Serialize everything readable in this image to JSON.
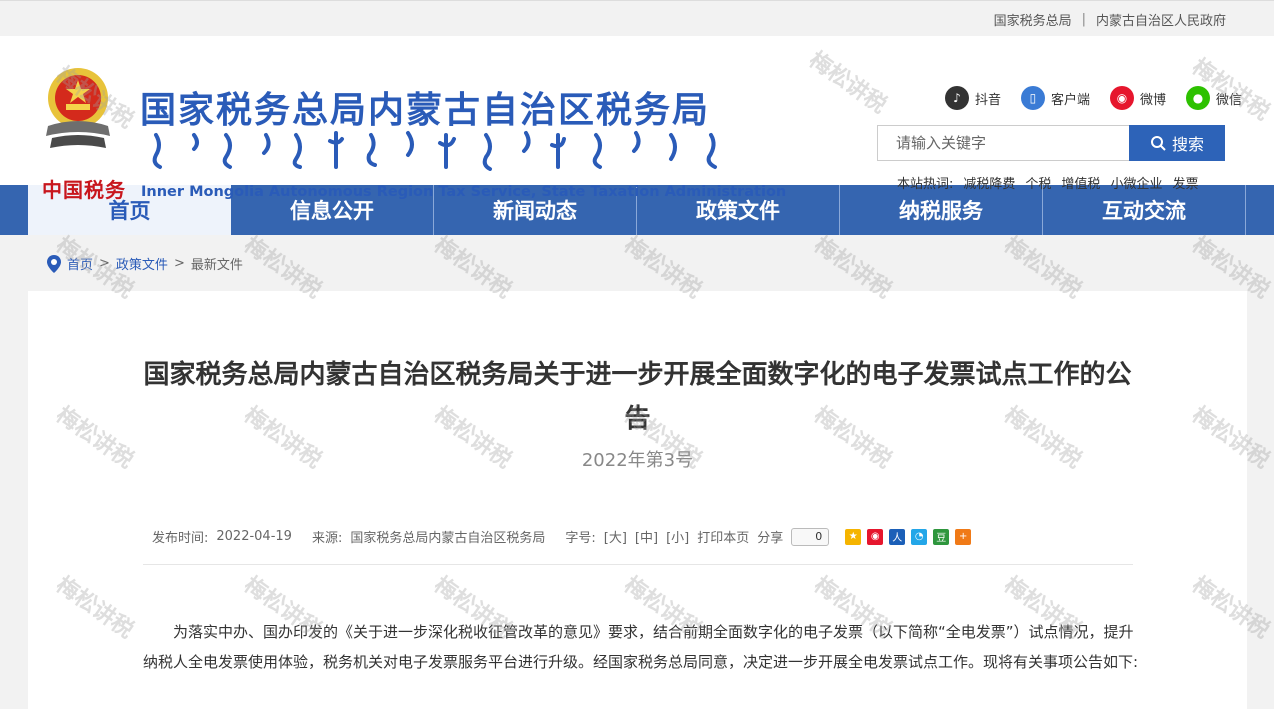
{
  "top_links": {
    "link1": "国家税务总局",
    "sep": "|",
    "link2": "内蒙古自治区人民政府"
  },
  "header": {
    "emblem_text": "中国税务",
    "title": "国家税务总局内蒙古自治区税务局",
    "title_en": "Inner Mongolia Autonomous Region Tax Service, State Taxation Administration"
  },
  "social": [
    {
      "label": "抖音",
      "icon": "douyin-icon"
    },
    {
      "label": "客户端",
      "icon": "mobile-client-icon"
    },
    {
      "label": "微博",
      "icon": "weibo-icon"
    },
    {
      "label": "微信",
      "icon": "wechat-icon"
    }
  ],
  "search": {
    "placeholder": "请输入关键字",
    "button_label": "搜索"
  },
  "hot": {
    "label": "本站热词:",
    "words": [
      "减税降费",
      "个税",
      "增值税",
      "小微企业",
      "发票"
    ]
  },
  "nav": [
    "首页",
    "信息公开",
    "新闻动态",
    "政策文件",
    "纳税服务",
    "互动交流"
  ],
  "breadcrumb": {
    "home": "首页",
    "sep": ">",
    "level2": "政策文件",
    "level3": "最新文件"
  },
  "article": {
    "title": "国家税务总局内蒙古自治区税务局关于进一步开展全面数字化的电子发票试点工作的公告",
    "number": "2022年第3号",
    "publish_label": "发布时间:",
    "publish_date": "2022-04-19",
    "source_label": "来源:",
    "source": "国家税务总局内蒙古自治区税务局",
    "fontsize_label": "字号:",
    "fs_large": "[大]",
    "fs_mid": "[中]",
    "fs_small": "[小]",
    "print_label": "打印本页",
    "share_label": "分享",
    "share_count": "0",
    "body": "为落实中办、国办印发的《关于进一步深化税收征管改革的意见》要求，结合前期全面数字化的电子发票（以下简称“全电发票”）试点情况，提升纳税人全电发票使用体验，税务机关对电子发票服务平台进行升级。经国家税务总局同意，决定进一步开展全电发票试点工作。现将有关事项公告如下:"
  },
  "watermark": "梅松讲税",
  "colors": {
    "brand_blue": "#2a5bb8",
    "nav_blue": "#3565b0",
    "emblem_red": "#c8161d"
  }
}
